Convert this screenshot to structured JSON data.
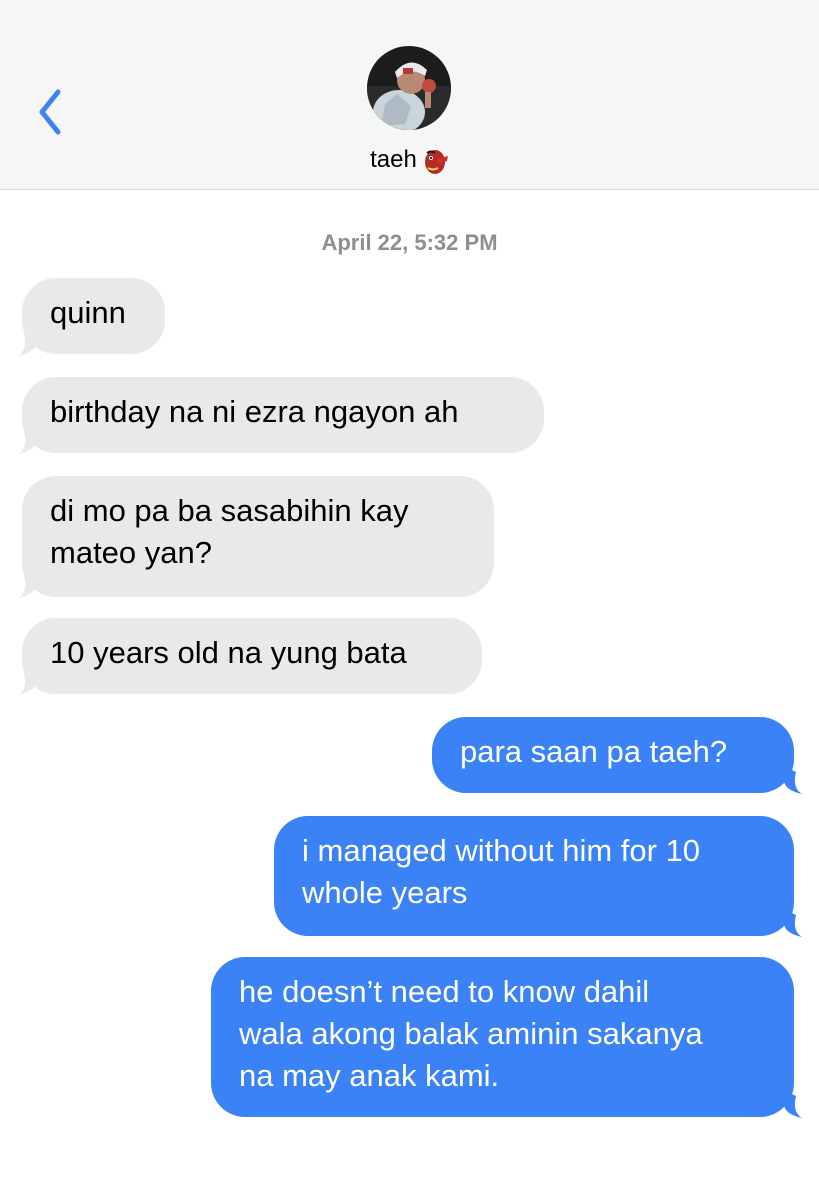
{
  "header": {
    "contact_name": "taeh",
    "contact_emoji_icon": "tengu-mask-icon",
    "back_icon": "chevron-left-icon",
    "accent": "#3a82f6"
  },
  "conversation": {
    "timestamp": "April 22, 5:32 PM",
    "messages": [
      {
        "direction": "incoming",
        "lines": [
          "quinn"
        ]
      },
      {
        "direction": "incoming",
        "lines": [
          "birthday na ni ezra ngayon ah"
        ]
      },
      {
        "direction": "incoming",
        "lines": [
          "di mo pa ba sasabihin kay",
          "mateo yan?"
        ]
      },
      {
        "direction": "incoming",
        "lines": [
          "10 years old na yung bata"
        ]
      },
      {
        "direction": "outgoing",
        "lines": [
          "para saan pa taeh?"
        ]
      },
      {
        "direction": "outgoing",
        "lines": [
          "i managed without him for 10",
          "whole years"
        ]
      },
      {
        "direction": "outgoing",
        "lines": [
          "he doesn’t need to know dahil",
          "wala akong balak aminin sakanya",
          "na may anak kami."
        ]
      }
    ]
  },
  "colors": {
    "incoming_bubble": "#e9e9eb",
    "outgoing_bubble": "#3a82f6",
    "header_bg": "#f6f6f7"
  }
}
